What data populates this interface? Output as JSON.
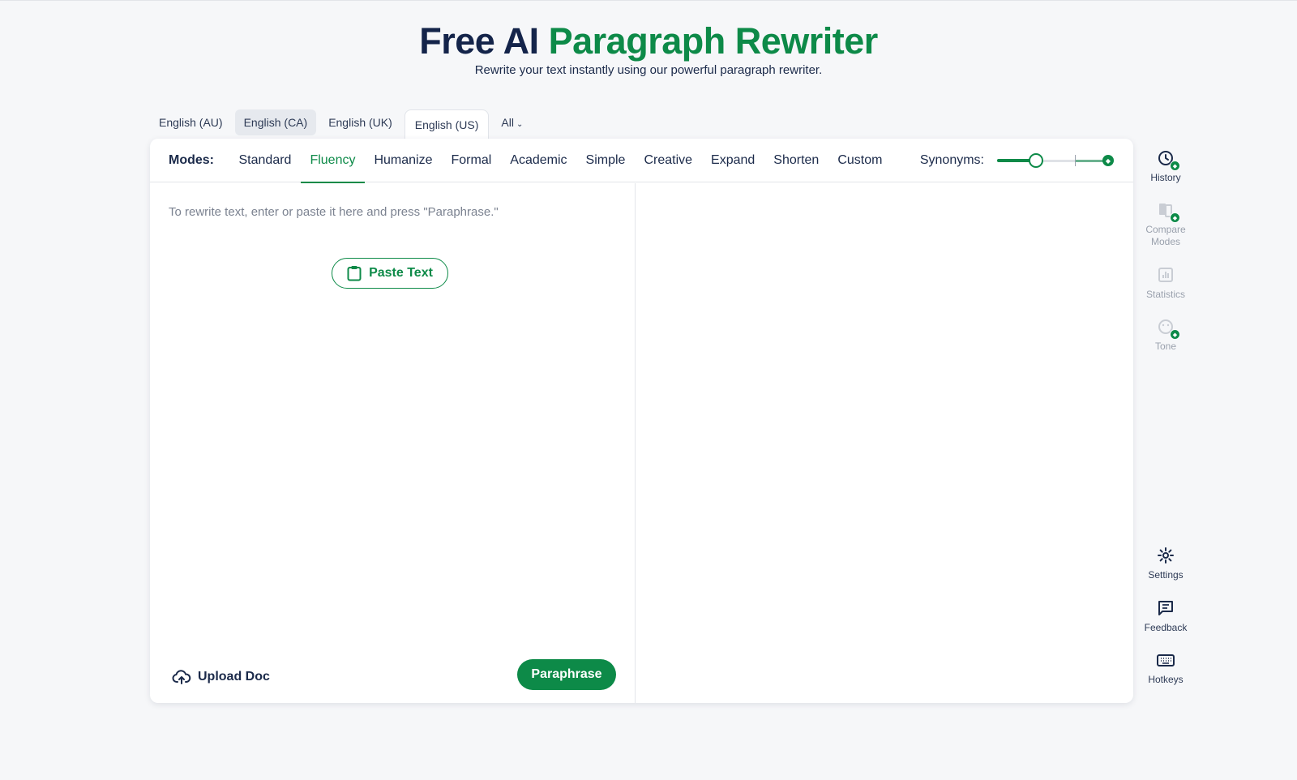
{
  "header": {
    "title_part1": "Free AI",
    "title_part2": "Paragraph Rewriter",
    "subtitle": "Rewrite your text instantly using our powerful paragraph rewriter."
  },
  "language_tabs": [
    {
      "label": "English (AU)"
    },
    {
      "label": "English (CA)"
    },
    {
      "label": "English (UK)"
    },
    {
      "label": "English (US)"
    },
    {
      "label": "All"
    }
  ],
  "active_language": "English (US)",
  "modes": {
    "label": "Modes:",
    "items": [
      "Standard",
      "Fluency",
      "Humanize",
      "Formal",
      "Academic",
      "Simple",
      "Creative",
      "Expand",
      "Shorten",
      "Custom"
    ],
    "active": "Fluency"
  },
  "synonyms": {
    "label": "Synonyms:",
    "level": 0.33
  },
  "input": {
    "placeholder": "To rewrite text, enter or paste it here and press \"Paraphrase.\"",
    "paste_label": "Paste Text",
    "upload_label": "Upload Doc",
    "paraphrase_label": "Paraphrase"
  },
  "sidebar": {
    "top": [
      {
        "label": "History",
        "icon": "history-icon",
        "premium": true,
        "disabled": false
      },
      {
        "label": "Compare Modes",
        "icon": "compare-modes-icon",
        "premium": true,
        "disabled": true
      },
      {
        "label": "Statistics",
        "icon": "statistics-icon",
        "premium": false,
        "disabled": true
      },
      {
        "label": "Tone",
        "icon": "tone-icon",
        "premium": true,
        "disabled": true
      }
    ],
    "bottom": [
      {
        "label": "Settings",
        "icon": "gear-icon"
      },
      {
        "label": "Feedback",
        "icon": "feedback-icon"
      },
      {
        "label": "Hotkeys",
        "icon": "keyboard-icon"
      }
    ]
  },
  "colors": {
    "brand_green": "#0d8a48",
    "title_navy": "#14244a",
    "background": "#f6f7f9"
  }
}
